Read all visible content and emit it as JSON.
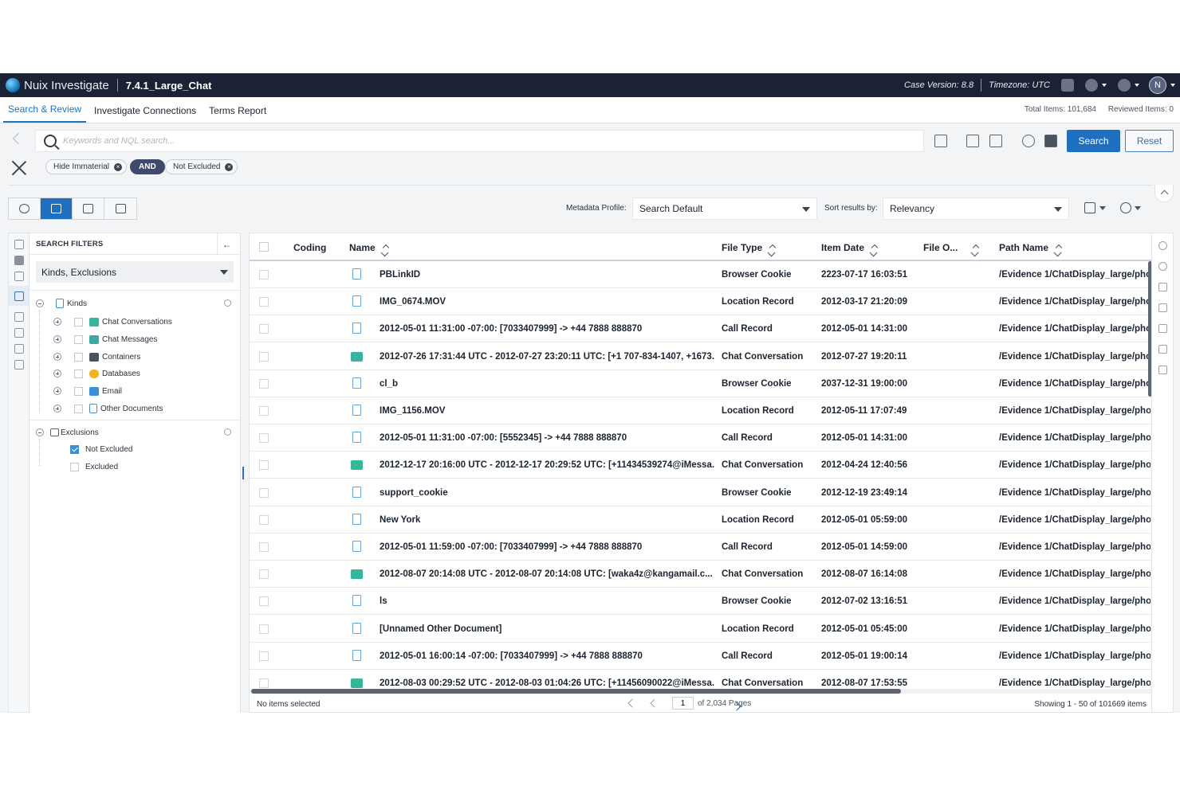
{
  "app": {
    "brand": "Nuix Investigate",
    "case_name": "7.4.1_Large_Chat",
    "case_version": "Case Version: 8.8",
    "timezone": "Timezone: UTC",
    "user_initial": "N"
  },
  "tabs": [
    {
      "label": "Search & Review",
      "active": true
    },
    {
      "label": "Investigate Connections",
      "active": false
    },
    {
      "label": "Terms Report",
      "active": false
    }
  ],
  "totals": {
    "total_items": "Total Items: 101,684",
    "reviewed_items": "Reviewed Items: 0"
  },
  "search": {
    "placeholder": "Keywords and NQL search...",
    "value": "",
    "search_label": "Search",
    "reset_label": "Reset"
  },
  "chips": {
    "hide_immaterial": "Hide Immaterial",
    "and": "AND",
    "not_excluded": "Not Excluded"
  },
  "toolbar": {
    "metadata_profile_label": "Metadata Profile:",
    "metadata_profile_value": "Search Default",
    "sort_label": "Sort results by:",
    "sort_value": "Relevancy"
  },
  "filters": {
    "title": "SEARCH FILTERS",
    "select_value": "Kinds, Exclusions",
    "kinds_label": "Kinds",
    "kinds": [
      "Chat Conversations",
      "Chat Messages",
      "Containers",
      "Databases",
      "Email",
      "Other Documents"
    ],
    "exclusions_label": "Exclusions",
    "exclusions": [
      {
        "label": "Not Excluded",
        "checked": true
      },
      {
        "label": "Excluded",
        "checked": false
      }
    ]
  },
  "grid": {
    "columns": {
      "coding": "Coding",
      "name": "Name",
      "file_type": "File Type",
      "item_date": "Item Date",
      "file_o": "File O...",
      "path_name": "Path Name"
    },
    "rows": [
      {
        "icon": "doc",
        "name": "PBLinkID",
        "type": "Browser Cookie",
        "date": "2223-07-17 16:03:51",
        "path": "/Evidence 1/ChatDisplay_large/pho"
      },
      {
        "icon": "doc",
        "name": "IMG_0674.MOV",
        "type": "Location Record",
        "date": "2012-03-17 21:20:09",
        "path": "/Evidence 1/ChatDisplay_large/pho"
      },
      {
        "icon": "doc",
        "name": "2012-05-01 11:31:00 -07:00: [7033407999] -> +44 7888 888870",
        "type": "Call Record",
        "date": "2012-05-01 14:31:00",
        "path": "/Evidence 1/ChatDisplay_large/pho"
      },
      {
        "icon": "chat",
        "name": "2012-07-26 17:31:44 UTC - 2012-07-27 23:20:11 UTC: [+1 707-834-1407, +1673...",
        "type": "Chat Conversation",
        "date": "2012-07-27 19:20:11",
        "path": "/Evidence 1/ChatDisplay_large/pho"
      },
      {
        "icon": "doc",
        "name": "cl_b",
        "type": "Browser Cookie",
        "date": "2037-12-31 19:00:00",
        "path": "/Evidence 1/ChatDisplay_large/pho"
      },
      {
        "icon": "doc",
        "name": "IMG_1156.MOV",
        "type": "Location Record",
        "date": "2012-05-11 17:07:49",
        "path": "/Evidence 1/ChatDisplay_large/pho"
      },
      {
        "icon": "doc",
        "name": "2012-05-01 11:31:00 -07:00: [5552345] -> +44 7888 888870",
        "type": "Call Record",
        "date": "2012-05-01 14:31:00",
        "path": "/Evidence 1/ChatDisplay_large/pho"
      },
      {
        "icon": "chat",
        "name": "2012-12-17 20:16:00 UTC - 2012-12-17 20:29:52 UTC: [+11434539274@iMessa...",
        "type": "Chat Conversation",
        "date": "2012-04-24 12:40:56",
        "path": "/Evidence 1/ChatDisplay_large/pho"
      },
      {
        "icon": "doc",
        "name": "support_cookie",
        "type": "Browser Cookie",
        "date": "2012-12-19 23:49:14",
        "path": "/Evidence 1/ChatDisplay_large/pho"
      },
      {
        "icon": "doc",
        "name": "New York",
        "type": "Location Record",
        "date": "2012-05-01 05:59:00",
        "path": "/Evidence 1/ChatDisplay_large/pho"
      },
      {
        "icon": "doc",
        "name": "2012-05-01 11:59:00 -07:00: [7033407999] -> +44 7888 888870",
        "type": "Call Record",
        "date": "2012-05-01 14:59:00",
        "path": "/Evidence 1/ChatDisplay_large/pho"
      },
      {
        "icon": "chat",
        "name": "2012-08-07 20:14:08 UTC - 2012-08-07 20:14:08 UTC: [waka4z@kangamail.c...",
        "type": "Chat Conversation",
        "date": "2012-08-07 16:14:08",
        "path": "/Evidence 1/ChatDisplay_large/pho"
      },
      {
        "icon": "doc",
        "name": "ls",
        "type": "Browser Cookie",
        "date": "2012-07-02 13:16:51",
        "path": "/Evidence 1/ChatDisplay_large/pho"
      },
      {
        "icon": "doc",
        "name": "[Unnamed Other Document]",
        "type": "Location Record",
        "date": "2012-05-01 05:45:00",
        "path": "/Evidence 1/ChatDisplay_large/pho"
      },
      {
        "icon": "doc",
        "name": "2012-05-01 16:00:14 -07:00: [7033407999] -> +44 7888 888870",
        "type": "Call Record",
        "date": "2012-05-01 19:00:14",
        "path": "/Evidence 1/ChatDisplay_large/pho"
      },
      {
        "icon": "chat",
        "name": "2012-08-03 00:29:52 UTC - 2012-08-03 01:04:26 UTC: [+11456090022@iMessa...",
        "type": "Chat Conversation",
        "date": "2012-08-07 17:53:55",
        "path": "/Evidence 1/ChatDisplay_large/pho"
      }
    ]
  },
  "footer": {
    "selection": "No items selected",
    "page_value": "1",
    "of_pages": "of 2,034 Pages",
    "showing": "Showing 1 - 50 of 101669 items"
  }
}
